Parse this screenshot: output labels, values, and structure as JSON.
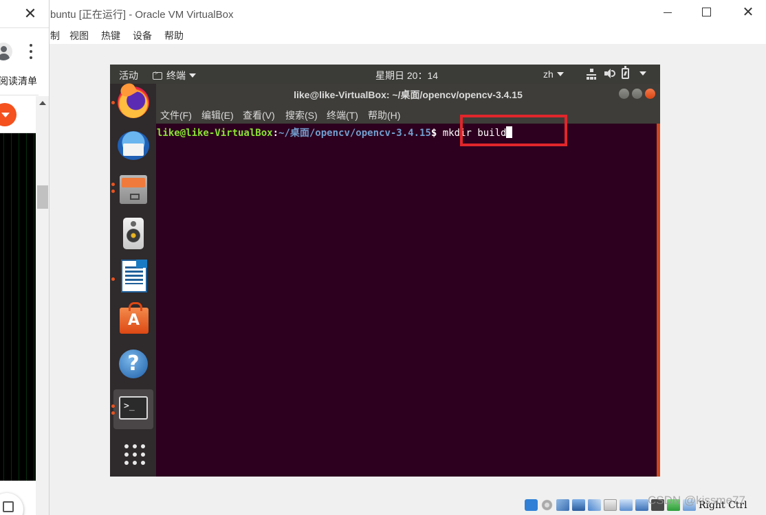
{
  "browser": {
    "close_glyph": "✕",
    "reading_list_label": "阅读清单"
  },
  "window": {
    "title": "buntu [正在运行] - Oracle VM VirtualBox",
    "minimize_label": "minimize",
    "maximize_label": "maximize",
    "close_glyph": "✕"
  },
  "vbox_menu": {
    "items": [
      "制",
      "视图",
      "热键",
      "设备",
      "帮助"
    ]
  },
  "ubuntu_topbar": {
    "activities": "活动",
    "app_menu": "终端",
    "clock": "星期日 20：14",
    "input_lang": "zh"
  },
  "dock": {
    "items": [
      {
        "name": "firefox",
        "running": true
      },
      {
        "name": "thunderbird",
        "running": false
      },
      {
        "name": "files",
        "running": true
      },
      {
        "name": "rhythmbox",
        "running": false
      },
      {
        "name": "libreoffice-writer",
        "running": true
      },
      {
        "name": "ubuntu-software",
        "running": false
      },
      {
        "name": "help",
        "running": false
      },
      {
        "name": "terminal",
        "running": true,
        "active": true
      },
      {
        "name": "show-applications",
        "running": false
      }
    ],
    "help_glyph": "?",
    "terminal_glyph": ">_"
  },
  "terminal": {
    "title": "like@like-VirtualBox: ~/桌面/opencv/opencv-3.4.15",
    "menu": [
      "文件(F)",
      "编辑(E)",
      "查看(V)",
      "搜索(S)",
      "终端(T)",
      "帮助(H)"
    ],
    "prompt_user": "like@like-VirtualBox",
    "prompt_colon": ":",
    "prompt_path": "~/桌面/opencv/opencv-3.4.15",
    "prompt_dollar": "$ ",
    "command": "mkdir build",
    "colors": {
      "background": "#2c001e",
      "user": "#8ae234",
      "path": "#729fcf",
      "accent": "#e95420"
    }
  },
  "statusbar": {
    "host_key": "Right Ctrl"
  },
  "watermark": "CSDN @kissme77",
  "highlight_color": "#e0262b"
}
